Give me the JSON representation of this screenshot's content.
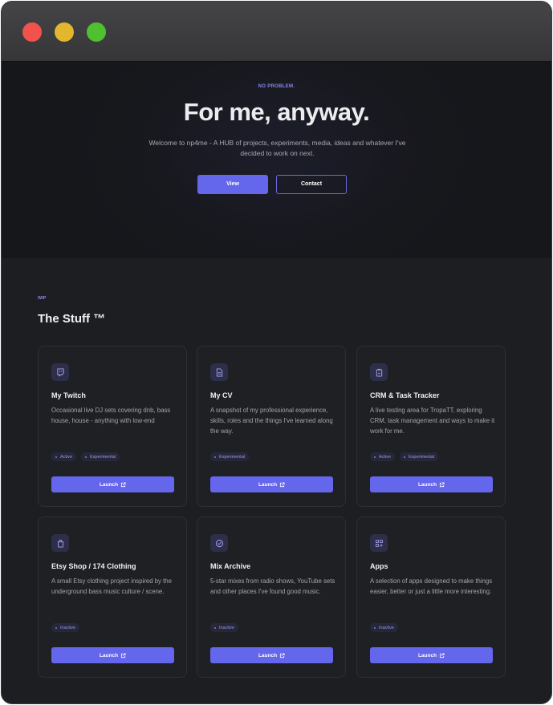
{
  "hero": {
    "eyebrow": "NO PROBLEM.",
    "title": "For me, anyway.",
    "subtitle": "Welcome to np4me - A HUB of projects, experiments, media, ideas and whatever I've decided to work on next.",
    "view_label": "View",
    "contact_label": "Contact"
  },
  "section": {
    "tag": "WIP",
    "title": "The Stuff ™"
  },
  "colors": {
    "accent": "#6466ec",
    "tag_text": "#9a98e6",
    "background": "#1d1e21"
  },
  "cards": [
    {
      "icon": "twitch-icon",
      "title": "My Twitch",
      "description": "Occasional live DJ sets covering dnb, bass house, house - anything with low-end",
      "tags": [
        "Active",
        "Experimental"
      ],
      "launch_label": "Launch"
    },
    {
      "icon": "document-icon",
      "title": "My CV",
      "description": "A snapshot of my professional experience, skills, roles and the things I've learned along the way.",
      "tags": [
        "Experimental"
      ],
      "launch_label": "Launch"
    },
    {
      "icon": "clipboard-icon",
      "title": "CRM & Task Tracker",
      "description": "A live testing area for TropaTT, exploring CRM, task management and ways to make it work for me.",
      "tags": [
        "Active",
        "Experimental"
      ],
      "launch_label": "Launch"
    },
    {
      "icon": "shopping-bag-icon",
      "title": "Etsy Shop / 174 Clothing",
      "description": "A small Etsy clothing project inspired by the underground bass music culture / scene.",
      "tags": [
        "Inactive"
      ],
      "launch_label": "Launch"
    },
    {
      "icon": "disc-icon",
      "title": "Mix Archive",
      "description": "5-star mixes from radio shows, YouTube sets and other places I've found good music.",
      "tags": [
        "Inactive"
      ],
      "launch_label": "Launch"
    },
    {
      "icon": "apps-grid-icon",
      "title": "Apps",
      "description": "A selection of apps designed to make things easier, better or just a little more interesting.",
      "tags": [
        "Inactive"
      ],
      "launch_label": "Launch"
    }
  ]
}
